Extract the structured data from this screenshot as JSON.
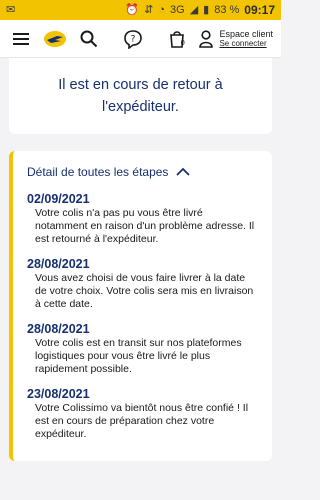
{
  "status_bar": {
    "network": "3G",
    "battery": "83 %",
    "time": "09:17"
  },
  "header": {
    "account_title": "Espace client",
    "account_link": "Se connecter"
  },
  "top_card": {
    "message": "Il est en cours de retour à l'expéditeur."
  },
  "steps": {
    "title": "Détail de toutes les étapes",
    "items": [
      {
        "date": "02/09/2021",
        "text": "Votre colis n'a pas pu vous être livré notamment en raison d'un problème adresse. Il est retourné à l'expéditeur."
      },
      {
        "date": "28/08/2021",
        "text": "Vous avez choisi de vous faire livrer à la date de votre choix. Votre colis sera mis en livraison à cette date."
      },
      {
        "date": "28/08/2021",
        "text": "Votre colis est en transit sur nos plateformes logistiques pour vous être livré le plus rapidement possible."
      },
      {
        "date": "23/08/2021",
        "text": "Votre Colissimo va bientôt nous être confié ! Il est en cours de préparation chez votre expéditeur."
      }
    ]
  },
  "colors": {
    "brand_yellow": "#f2c300",
    "brand_blue": "#17306f"
  }
}
